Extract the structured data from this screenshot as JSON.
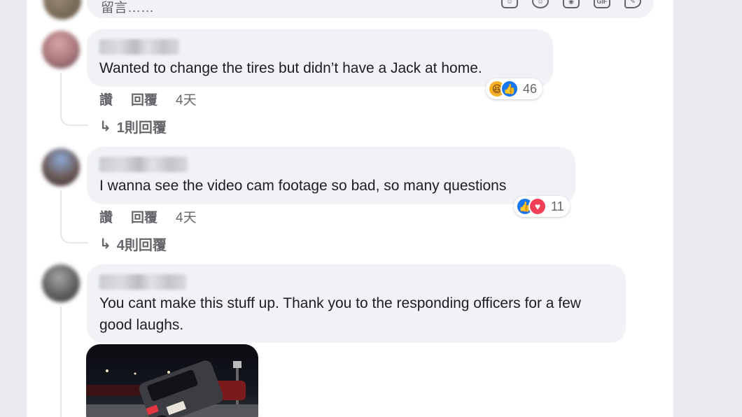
{
  "composer": {
    "placeholder": "留言……",
    "icons": [
      "sticker-icon",
      "emoji-icon",
      "camera-icon",
      "gif-icon",
      "sticker-pen-icon"
    ],
    "gif_label": "GIF"
  },
  "comments": [
    {
      "text": "Wanted to change the tires but didn’t have a Jack at home.",
      "like_label": "讚",
      "reply_label": "回覆",
      "time": "4天",
      "reaction_icons": [
        "haha-icon",
        "like-icon"
      ],
      "reaction_count": "46",
      "replies_label": "1則回覆"
    },
    {
      "text": "I wanna see the video cam footage so bad, so many questions",
      "like_label": "讚",
      "reply_label": "回覆",
      "time": "4天",
      "reaction_icons": [
        "like-icon",
        "love-icon"
      ],
      "reaction_count": "11",
      "replies_label": "4則回覆"
    },
    {
      "text": "You cant make this stuff up. Thank you to the responding officers for a few good laughs."
    }
  ],
  "colors": {
    "bubble": "#f0f2f5",
    "secondary_text": "#65676b",
    "like_blue": "#1877f2",
    "love_red": "#f33e58",
    "haha_yellow": "#f7b125"
  }
}
